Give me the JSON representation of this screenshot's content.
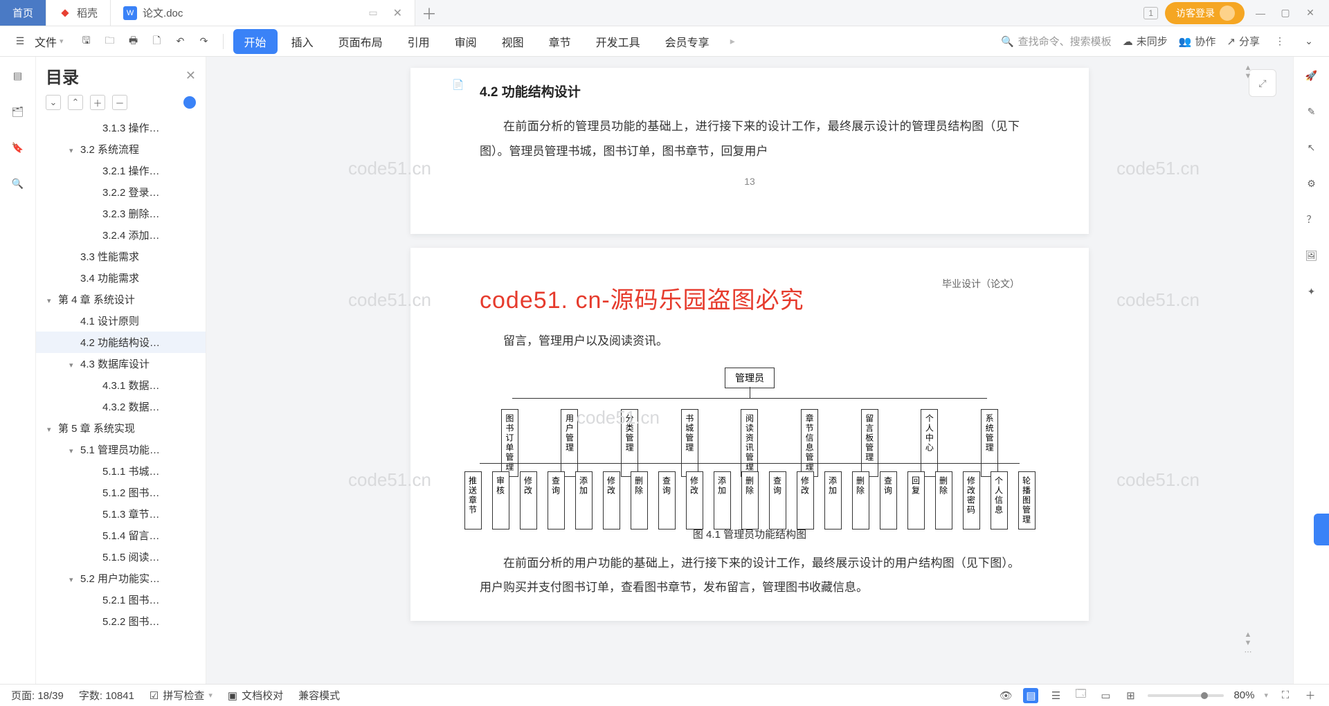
{
  "tabs": {
    "home": "首页",
    "daoke": "稻壳",
    "doc": "论文.doc"
  },
  "titleRight": {
    "badge": "1",
    "login": "访客登录"
  },
  "ribbon": {
    "file": "文件",
    "tabs": [
      "开始",
      "插入",
      "页面布局",
      "引用",
      "审阅",
      "视图",
      "章节",
      "开发工具",
      "会员专享"
    ],
    "search": "查找命令、搜索模板",
    "sync": "未同步",
    "collab": "协作",
    "share": "分享"
  },
  "outline": {
    "title": "目录",
    "items": [
      {
        "txt": "3.1.3 操作…",
        "indent": 4
      },
      {
        "txt": "3.2 系统流程",
        "indent": 2,
        "chev": "▾"
      },
      {
        "txt": "3.2.1 操作…",
        "indent": 4
      },
      {
        "txt": "3.2.2 登录…",
        "indent": 4
      },
      {
        "txt": "3.2.3 删除…",
        "indent": 4
      },
      {
        "txt": "3.2.4 添加…",
        "indent": 4
      },
      {
        "txt": "3.3 性能需求",
        "indent": 2
      },
      {
        "txt": "3.4 功能需求",
        "indent": 2
      },
      {
        "txt": "第 4 章  系统设计",
        "indent": 0,
        "chev": "▾"
      },
      {
        "txt": "4.1 设计原则",
        "indent": 2
      },
      {
        "txt": "4.2 功能结构设…",
        "indent": 2,
        "active": true
      },
      {
        "txt": "4.3 数据库设计",
        "indent": 2,
        "chev": "▾"
      },
      {
        "txt": "4.3.1 数据…",
        "indent": 4
      },
      {
        "txt": "4.3.2 数据…",
        "indent": 4
      },
      {
        "txt": "第 5 章  系统实现",
        "indent": 0,
        "chev": "▾"
      },
      {
        "txt": "5.1 管理员功能…",
        "indent": 2,
        "chev": "▾"
      },
      {
        "txt": "5.1.1 书城…",
        "indent": 4
      },
      {
        "txt": "5.1.2 图书…",
        "indent": 4
      },
      {
        "txt": "5.1.3 章节…",
        "indent": 4
      },
      {
        "txt": "5.1.4 留言…",
        "indent": 4
      },
      {
        "txt": "5.1.5 阅读…",
        "indent": 4
      },
      {
        "txt": "5.2 用户功能实…",
        "indent": 2,
        "chev": "▾"
      },
      {
        "txt": "5.2.1 图书…",
        "indent": 4
      },
      {
        "txt": "5.2.2 图书…",
        "indent": 4
      }
    ]
  },
  "doc": {
    "secTitle": "4.2  功能结构设计",
    "p1": "在前面分析的管理员功能的基础上，进行接下来的设计工作，最终展示设计的管理员结构图（见下图）。管理员管理书城，图书订单，图书章节，回复用户",
    "pageNum": "13",
    "banner": "code51. cn-源码乐园盗图必究",
    "headerR": "毕业设计（论文）",
    "p2a": "留言，管理用户以及阅读资讯。",
    "figCap": "图 4.1  管理员功能结构图",
    "p3": "在前面分析的用户功能的基础上，进行接下来的设计工作，最终展示设计的用户结构图（见下图）。用户购买并支付图书订单，查看图书章节，发布留言，管理图书收藏信息。",
    "watermark": "code51.cn",
    "diagram": {
      "root": "管理员",
      "mid": [
        "图书订单管理",
        "用户管理",
        "分类管理",
        "书城管理",
        "阅读资讯管理",
        "章节信息管理",
        "留言板管理",
        "个人中心",
        "系统管理"
      ],
      "leaf": [
        "推送章节",
        "审核",
        "修改",
        "查询",
        "添加",
        "修改",
        "删除",
        "查询",
        "修改",
        "添加",
        "删除",
        "查询",
        "修改",
        "添加",
        "删除",
        "查询",
        "回复",
        "删除",
        "修改密码",
        "个人信息",
        "轮播图管理"
      ]
    }
  },
  "status": {
    "page": "页面: 18/39",
    "words": "字数: 10841",
    "spell": "拼写检查",
    "proof": "文档校对",
    "compat": "兼容模式",
    "zoom": "80%"
  }
}
